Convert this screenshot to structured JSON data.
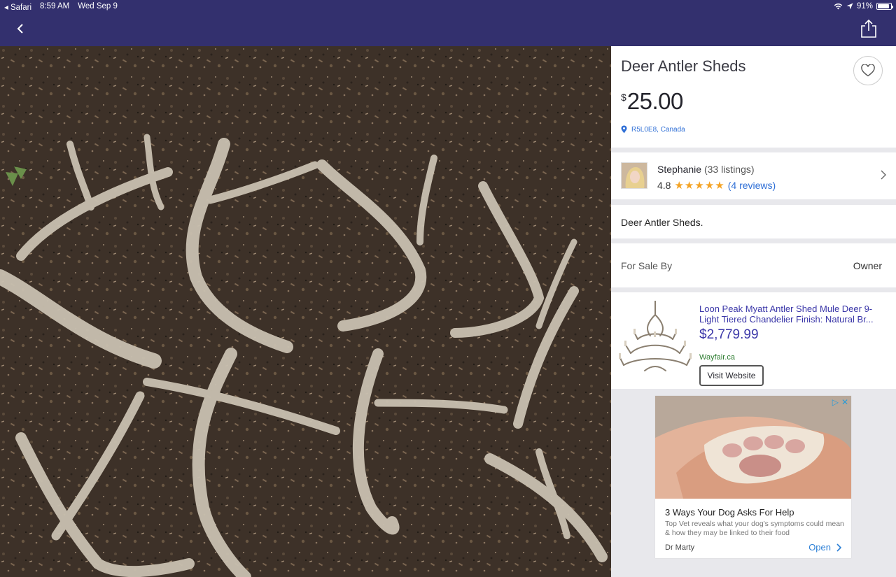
{
  "status_bar": {
    "back_app": "Safari",
    "time": "8:59 AM",
    "date": "Wed Sep 9",
    "battery": "91%",
    "battery_level": 0.91
  },
  "nav": {
    "back_icon": "chevron-left-icon",
    "share_icon": "share-icon"
  },
  "listing": {
    "title": "Deer Antler Sheds",
    "currency_symbol": "$",
    "price": "25.00",
    "location": "R5L0E8, Canada",
    "description": "Deer Antler Sheds."
  },
  "seller": {
    "name": "Stephanie",
    "listings": "(33 listings)",
    "rating": "4.8",
    "stars": 5,
    "reviews": "(4 reviews)"
  },
  "details": {
    "for_sale_by_label": "For Sale By",
    "for_sale_by_value": "Owner"
  },
  "product_ad": {
    "title": "Loon Peak Myatt Antler Shed Mule Deer 9-Light Tiered Chandelier Finish: Natural Br...",
    "price": "$2,779.99",
    "domain": "Wayfair.ca",
    "button": "Visit Website"
  },
  "display_ad": {
    "title": "3 Ways Your Dog Asks For Help",
    "body": "Top Vet reveals what your dog's symptoms could mean & how they may be linked to their food",
    "brand": "Dr Marty",
    "cta": "Open"
  },
  "colors": {
    "header": "#33306e",
    "link": "#2f6fd6",
    "ad_text": "#3a36a8",
    "star": "#f4a324"
  }
}
